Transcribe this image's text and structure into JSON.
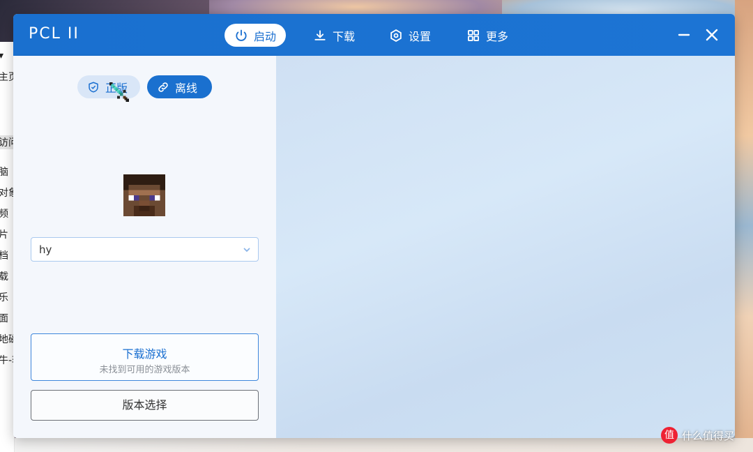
{
  "window": {
    "title": "PCL II",
    "nav": [
      {
        "label": "启动",
        "icon": "power-icon",
        "active": true
      },
      {
        "label": "下载",
        "icon": "download-icon",
        "active": false
      },
      {
        "label": "设置",
        "icon": "settings-icon",
        "active": false
      },
      {
        "label": "更多",
        "icon": "grid-icon",
        "active": false
      }
    ],
    "controls": {
      "minimize": "minimize-icon",
      "close": "close-icon"
    }
  },
  "login": {
    "modes": [
      {
        "label": "正版",
        "icon": "shield-icon",
        "selected": false
      },
      {
        "label": "离线",
        "icon": "link-icon",
        "selected": true
      }
    ],
    "username": "hy"
  },
  "launch": {
    "download_title": "下载游戏",
    "download_subtitle": "未找到可用的游戏版本",
    "version_select": "版本选择"
  },
  "explorer_behind": [
    "主页",
    "访问",
    "脑",
    "对象",
    "频",
    "片",
    "档",
    "载",
    "乐",
    "面",
    "地磁",
    "牛-软"
  ],
  "watermark": "什么值得买",
  "colors": {
    "accent": "#1a70cf",
    "panel": "#f4f7fc"
  }
}
